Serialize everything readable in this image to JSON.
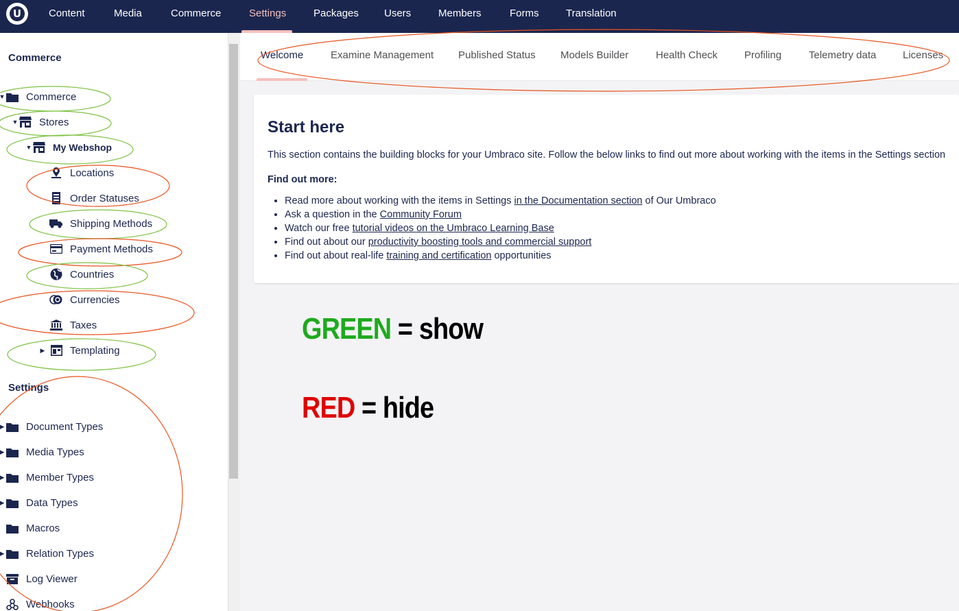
{
  "header": {
    "logo": "U",
    "nav": [
      {
        "label": "Content"
      },
      {
        "label": "Media"
      },
      {
        "label": "Commerce"
      },
      {
        "label": "Settings"
      },
      {
        "label": "Packages"
      },
      {
        "label": "Users"
      },
      {
        "label": "Members"
      },
      {
        "label": "Forms"
      },
      {
        "label": "Translation"
      }
    ],
    "active": "Settings"
  },
  "sidebar": {
    "commerce_heading": "Commerce",
    "commerce_tree": [
      {
        "label": "Commerce",
        "icon": "folder-icon"
      },
      {
        "label": "Stores",
        "icon": "store-icon"
      },
      {
        "label": "My Webshop",
        "icon": "store-icon"
      },
      {
        "label": "Locations",
        "icon": "location-icon"
      },
      {
        "label": "Order Statuses",
        "icon": "receipt-icon"
      },
      {
        "label": "Shipping Methods",
        "icon": "truck-icon"
      },
      {
        "label": "Payment Methods",
        "icon": "credit-card-icon"
      },
      {
        "label": "Countries",
        "icon": "globe-icon"
      },
      {
        "label": "Currencies",
        "icon": "coins-icon"
      },
      {
        "label": "Taxes",
        "icon": "bank-icon"
      },
      {
        "label": "Templating",
        "icon": "template-icon"
      }
    ],
    "settings_heading": "Settings",
    "settings_tree": [
      {
        "label": "Document Types",
        "icon": "folder-icon"
      },
      {
        "label": "Media Types",
        "icon": "folder-icon"
      },
      {
        "label": "Member Types",
        "icon": "folder-icon"
      },
      {
        "label": "Data Types",
        "icon": "folder-icon"
      },
      {
        "label": "Macros",
        "icon": "folder-icon"
      },
      {
        "label": "Relation Types",
        "icon": "folder-icon"
      },
      {
        "label": "Log Viewer",
        "icon": "archive-icon"
      },
      {
        "label": "Webhooks",
        "icon": "webhook-icon"
      }
    ]
  },
  "tabs": [
    {
      "label": "Welcome"
    },
    {
      "label": "Examine Management"
    },
    {
      "label": "Published Status"
    },
    {
      "label": "Models Builder"
    },
    {
      "label": "Health Check"
    },
    {
      "label": "Profiling"
    },
    {
      "label": "Telemetry data"
    },
    {
      "label": "Licenses"
    }
  ],
  "welcome": {
    "title": "Start here",
    "intro": "This section contains the building blocks for your Umbraco site. Follow the below links to find out more about working with the items in the Settings section",
    "find_more": "Find out more:",
    "links": [
      {
        "before": "Read more about working with the items in Settings ",
        "link": "in the Documentation section",
        "after": " of Our Umbraco"
      },
      {
        "before": "Ask a question in the ",
        "link": "Community Forum",
        "after": ""
      },
      {
        "before": "Watch our free ",
        "link": "tutorial videos on the Umbraco Learning Base",
        "after": ""
      },
      {
        "before": "Find out about our ",
        "link": "productivity boosting tools and commercial support",
        "after": ""
      },
      {
        "before": "Find out about real-life ",
        "link": "training and certification",
        "after": " opportunities"
      }
    ]
  },
  "legend": {
    "green_word": "GREEN",
    "green_rest": " = show",
    "red_word": "RED",
    "red_rest": " = hide"
  },
  "colors": {
    "header_bg": "#1b264f",
    "active_accent": "#f5c1bc",
    "annotation_green": "#7dc242",
    "annotation_red": "#e8531e"
  }
}
